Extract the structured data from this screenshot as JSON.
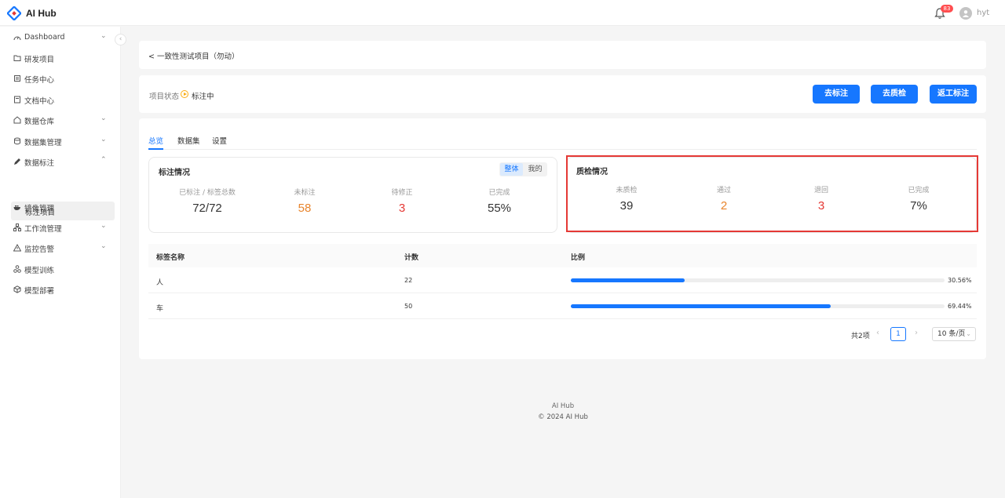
{
  "app": {
    "name": "AI Hub",
    "notifications": "83",
    "user": "hyt"
  },
  "sidebar": {
    "items": [
      {
        "label": "Dashboard",
        "icon": "dashboard-icon",
        "chevron": "⌄"
      },
      {
        "label": "研发项目",
        "icon": "folder-icon",
        "chevron": ""
      },
      {
        "label": "任务中心",
        "icon": "task-icon",
        "chevron": ""
      },
      {
        "label": "文档中心",
        "icon": "document-icon",
        "chevron": ""
      },
      {
        "label": "数据仓库",
        "icon": "warehouse-icon",
        "chevron": "⌄"
      },
      {
        "label": "数据集管理",
        "icon": "database-icon",
        "chevron": "⌄"
      },
      {
        "label": "数据标注",
        "icon": "pen-icon",
        "chevron": "⌃"
      },
      {
        "label": "镜像管理",
        "icon": "docker-icon",
        "chevron": ""
      },
      {
        "label": "工作流管理",
        "icon": "workflow-icon",
        "chevron": "⌄"
      },
      {
        "label": "监控告警",
        "icon": "alert-icon",
        "chevron": "⌄"
      },
      {
        "label": "模型训练",
        "icon": "model-training-icon",
        "chevron": ""
      },
      {
        "label": "模型部署",
        "icon": "cube-icon",
        "chevron": ""
      }
    ],
    "sub_active": "标注项目"
  },
  "breadcrumb": {
    "back": "<",
    "title": "一致性测试项目（勿动）"
  },
  "project": {
    "status_key": "项目状态",
    "status_value": "标注中",
    "buttons": [
      "去标注",
      "去质检",
      "返工标注"
    ]
  },
  "tabs": [
    "总览",
    "数据集",
    "设置"
  ],
  "annotation": {
    "title": "标注情况",
    "segments": [
      "整体",
      "我的"
    ],
    "stats": [
      {
        "label": "已标注 / 标签总数",
        "value": "72/72",
        "color": "#333333"
      },
      {
        "label": "未标注",
        "value": "58",
        "color": "#e8842c"
      },
      {
        "label": "待修正",
        "value": "3",
        "color": "#e53935"
      },
      {
        "label": "已完成",
        "value": "55%",
        "color": "#333333"
      }
    ]
  },
  "qc": {
    "title": "质检情况",
    "stats": [
      {
        "label": "未质检",
        "value": "39",
        "color": "#333333"
      },
      {
        "label": "通过",
        "value": "2",
        "color": "#e8842c"
      },
      {
        "label": "退回",
        "value": "3",
        "color": "#e53935"
      },
      {
        "label": "已完成",
        "value": "7%",
        "color": "#333333"
      }
    ]
  },
  "table": {
    "headers": [
      "标签名称",
      "计数",
      "比例"
    ],
    "rows": [
      {
        "name": "人",
        "count": "22",
        "percent": "30.56%",
        "ratio": 0.3056
      },
      {
        "name": "车",
        "count": "50",
        "percent": "69.44%",
        "ratio": 0.6944
      }
    ]
  },
  "pagination": {
    "total": "共2项",
    "page": "1",
    "page_size": "10 条/页"
  },
  "footer": {
    "line1": "AI Hub",
    "line2": "© 2024 AI Hub"
  },
  "colors": {
    "primary": "#1677ff",
    "warning": "#e8842c",
    "danger": "#e53935",
    "highlight_box": "#e53935"
  }
}
